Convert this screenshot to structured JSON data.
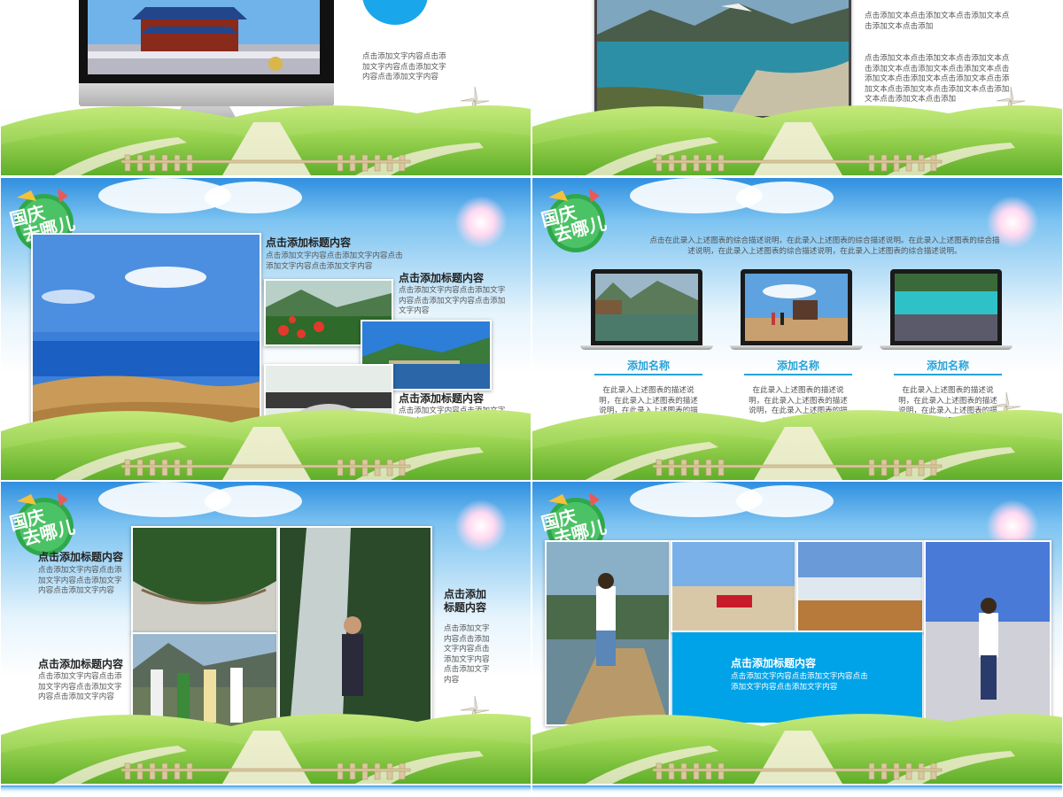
{
  "slide1": {
    "body": "点击添加文字内容点击添加文字内容点击添加文字内容点击添加文字内容"
  },
  "slide2": {
    "body1": "点击添加文本点击添加文本点击添加文本点击添加文本点击添加",
    "body2": "点击添加文本点击添加文本点击添加文本点击添加文本点击添加文本点击添加文本点击添加文本点击添加文本点击添加文本点击添加文本点击添加文本点击添加文本点击添加文本点击添加文本点击添加"
  },
  "slide3": {
    "title1": "点击添加标题内容",
    "body1": "点击添加文字内容点击添加文字内容点击添加文字内容点击添加文字内容",
    "title2": "点击添加标题内容",
    "body2": "点击添加文字内容点击添加文字内容点击添加文字内容点击添加文字内容",
    "title3": "点击添加标题内容",
    "body3": "点击添加文字内容点击添加文字内容点击添加文字内容点击添加文字内容"
  },
  "slide4": {
    "intro": "点击在此录入上述图表的综合描述说明，在此录入上述图表的综合描述说明。在此录入上述图表的综合描述说明，在此录入上述图表的综合描述说明，在此录入上述图表的综合描述说明。",
    "cards": [
      {
        "name": "添加名称",
        "desc": "在此录入上述图表的描述说明，在此录入上述图表的描述说明，在此录入上述图表的描述说明。"
      },
      {
        "name": "添加名称",
        "desc": "在此录入上述图表的描述说明，在此录入上述图表的描述说明，在此录入上述图表的描述说明。"
      },
      {
        "name": "添加名称",
        "desc": "在此录入上述图表的描述说明，在此录入上述图表的描述说明，在此录入上述图表的描述说明。"
      }
    ]
  },
  "slide5": {
    "title1": "点击添加标题内容",
    "body1": "点击添加文字内容点击添加文字内容点击添加文字内容点击添加文字内容",
    "title2": "点击添加标题内容",
    "body2": "点击添加文字内容点击添加文字内容点击添加文字内容点击添加文字内容",
    "title3a": "点击添加",
    "title3b": "标题内容",
    "body3": "点击添加文字内容点击添加文字内容点击添加文字内容点击添加文字内容"
  },
  "slide6": {
    "title": "点击添加标题内容",
    "body": "点击添加文字内容点击添加文字内容点击添加文字内容点击添加文字内容"
  },
  "logo_text": {
    "line1": "国庆",
    "line2": "去哪儿"
  },
  "colors": {
    "accent": "#00a2e8",
    "label": "#27a3d8",
    "grass": "#7cc43a",
    "sky": "#2f8fe0"
  }
}
